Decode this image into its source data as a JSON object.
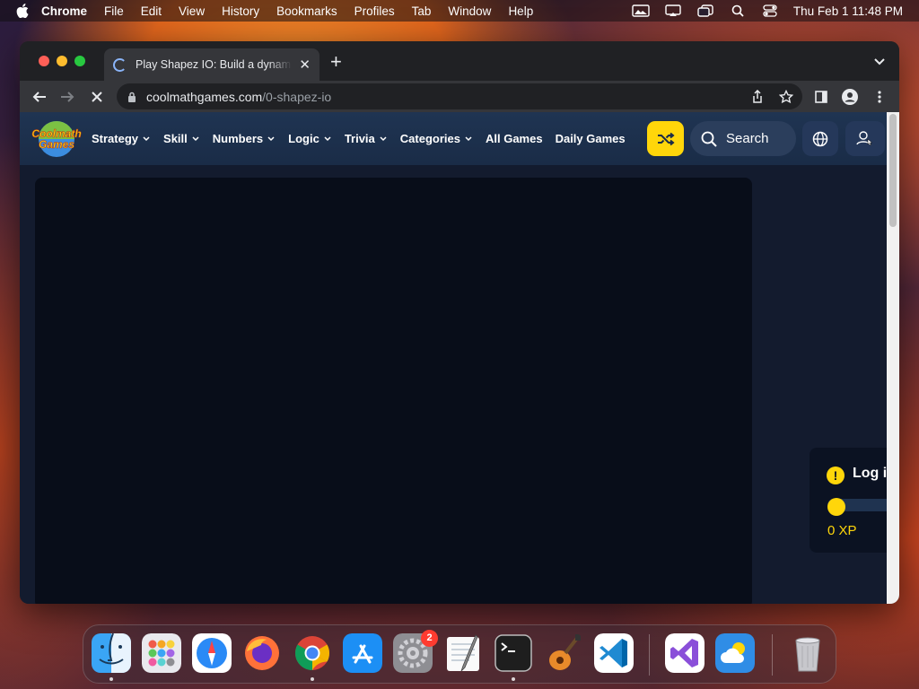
{
  "menubar": {
    "app_name": "Chrome",
    "items": [
      "File",
      "Edit",
      "View",
      "History",
      "Bookmarks",
      "Profiles",
      "Tab",
      "Window",
      "Help"
    ],
    "clock": "Thu Feb 1  11:48 PM"
  },
  "browser": {
    "tab_title": "Play Shapez IO: Build a dynamic",
    "url_domain": "coolmathgames.com",
    "url_path": "/0-shapez-io"
  },
  "site": {
    "logo_text": [
      "Coolmath",
      "Games"
    ],
    "nav": {
      "strategy": "Strategy",
      "skill": "Skill",
      "numbers": "Numbers",
      "logic": "Logic",
      "trivia": "Trivia",
      "categories": "Categories",
      "all_games": "All Games",
      "daily_games": "Daily Games"
    },
    "search_placeholder": "Search",
    "xp_panel": {
      "warning_glyph": "!",
      "login_text": "Log i",
      "xp_label": "0 XP",
      "progress": 0
    }
  },
  "dock": {
    "apps": [
      "finder-icon",
      "launchpad-icon",
      "safari-icon",
      "firefox-icon",
      "chrome-icon",
      "app-store-icon",
      "system-settings-icon",
      "textedit-icon",
      "terminal-icon",
      "garageband-icon",
      "vscode-icon",
      "visual-studio-icon",
      "weather-icon",
      "trash-icon"
    ],
    "system_settings_badge": "2"
  },
  "colors": {
    "accent_yellow": "#ffd60a",
    "nav_bg": "#1f3452",
    "page_bg": "#131b2e"
  }
}
